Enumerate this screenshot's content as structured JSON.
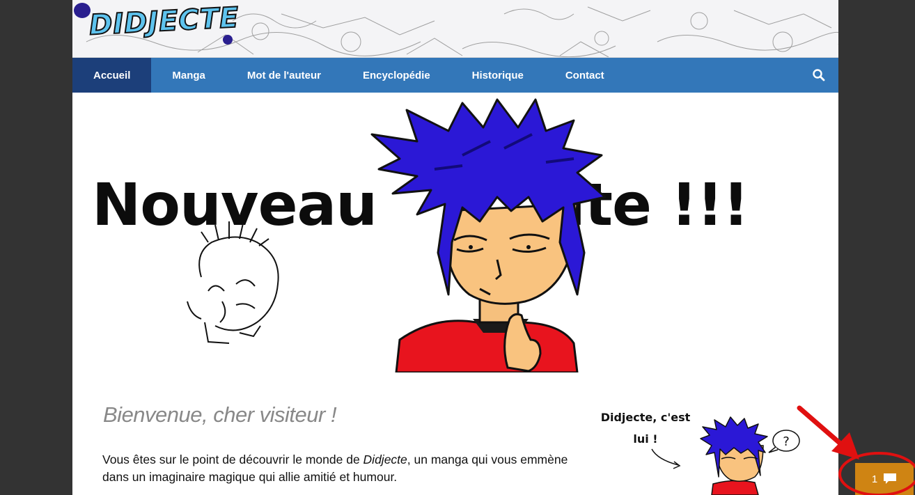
{
  "site": {
    "logo_text": "DIDJECTE"
  },
  "nav": {
    "items": [
      {
        "label": "Accueil",
        "active": true
      },
      {
        "label": "Manga"
      },
      {
        "label": "Mot de l'auteur"
      },
      {
        "label": "Encyclopédie"
      },
      {
        "label": "Historique"
      },
      {
        "label": "Contact"
      }
    ],
    "search_icon": "search-icon"
  },
  "hero": {
    "headline_left": "Nouveau",
    "headline_right": "site !!!"
  },
  "content": {
    "welcome_title": "Bienvenue, cher visiteur !",
    "intro_before": "Vous êtes sur le point de découvrir le monde de ",
    "intro_em": "Didjecte",
    "intro_after": ", un manga qui vous emmène dans un imaginaire magique qui allie amitié et humour.",
    "side_caption_line1": "Didjecte, c'est",
    "side_caption_line2": "lui !",
    "thought_bubble": "?"
  },
  "comments": {
    "count": "1",
    "icon": "comment-icon"
  },
  "colors": {
    "nav_bg": "#3377b9",
    "nav_active": "#1c3f7a",
    "comment_btn": "#cf8413",
    "annotation": "#e01010"
  }
}
